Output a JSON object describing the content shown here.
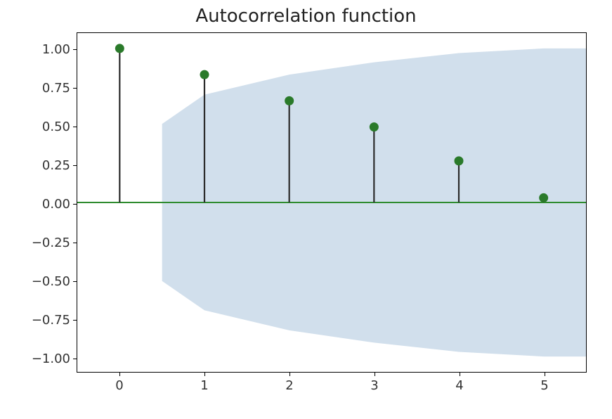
{
  "chart_data": {
    "type": "bar",
    "title": "Autocorrelation function",
    "xlabel": "",
    "ylabel": "",
    "categories": [
      0,
      1,
      2,
      3,
      4,
      5
    ],
    "values": [
      1.0,
      0.83,
      0.66,
      0.49,
      0.27,
      0.03
    ],
    "confidence_band_upper": [
      0.51,
      0.7,
      0.83,
      0.91,
      0.97,
      1.0
    ],
    "confidence_band_lower": [
      -0.51,
      -0.7,
      -0.83,
      -0.91,
      -0.97,
      -1.0
    ],
    "confidence_band_start": 0.5,
    "ylim": [
      -1.1,
      1.1
    ],
    "xlim": [
      -0.5,
      5.5
    ],
    "yticks": [
      -1.0,
      -0.75,
      -0.5,
      -0.25,
      0.0,
      0.25,
      0.5,
      0.75,
      1.0
    ],
    "xticks": [
      0,
      1,
      2,
      3,
      4,
      5
    ],
    "colors": {
      "marker": "#2a7a2a",
      "stem": "#2b2b2b",
      "zero_line": "#2e8b2e",
      "ci_band": "#c9d9e9"
    }
  },
  "ytick_labels": [
    "−1.00",
    "−0.75",
    "−0.50",
    "−0.25",
    "0.00",
    "0.25",
    "0.50",
    "0.75",
    "1.00"
  ],
  "xtick_labels": [
    "0",
    "1",
    "2",
    "3",
    "4",
    "5"
  ]
}
